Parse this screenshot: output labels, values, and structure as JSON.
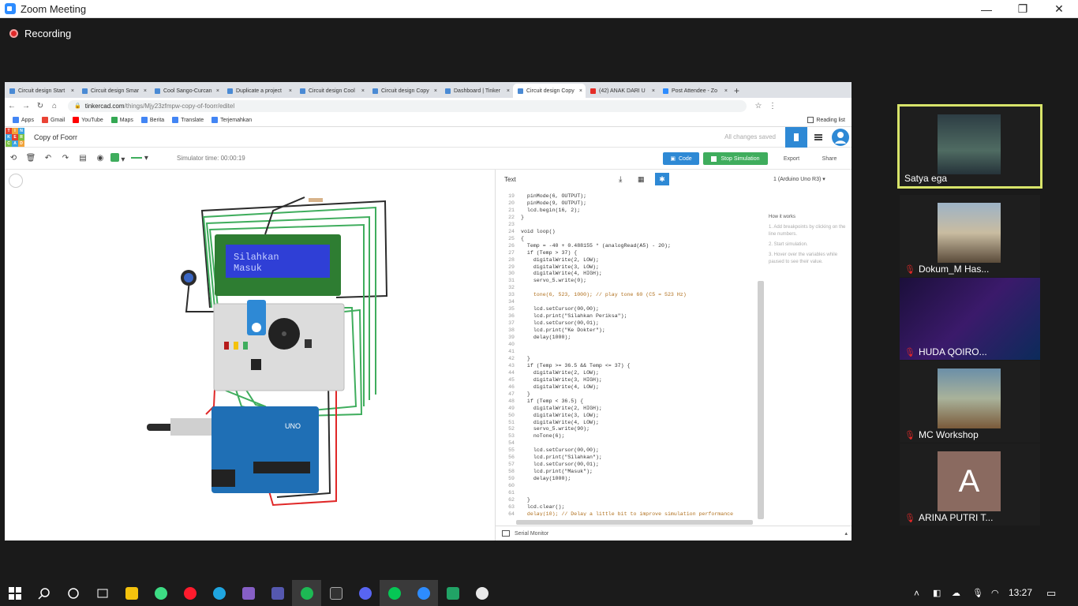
{
  "zoom": {
    "title": "Zoom Meeting",
    "recording": "Recording",
    "minimize": "—",
    "restore": "❐",
    "close": "✕"
  },
  "browser": {
    "tabs": [
      "Circuit design Start",
      "Circuit design Smar",
      "Cool Sango-Curcan",
      "Duplicate a project",
      "Circuit design Cool",
      "Circuit design Copy",
      "Dashboard | Tinker",
      "Circuit design Copy",
      "(42) ANAK DARI U",
      "Post Attendee - Zo"
    ],
    "tab_close": "×",
    "new_tab": "+",
    "url_host": "tinkercad.com",
    "url_path": "/things/Mjy23zfmpw-copy-of-foorr/editel",
    "bookmarks": [
      "Apps",
      "Gmail",
      "YouTube",
      "Maps",
      "Berita",
      "Translate",
      "Terjemahkan"
    ],
    "reading_list": "Reading list"
  },
  "tinkercad": {
    "logo_letters": [
      "T",
      "I",
      "N",
      "K",
      "E",
      "R",
      "C",
      "A",
      "D"
    ],
    "project_name": "Copy of Foorr",
    "save_status": "All changes saved",
    "simulator_time": "Simulator time: 00:00:19",
    "code_button": "Code",
    "stop_button": "Stop Simulation",
    "export_button": "Export",
    "share_button": "Share",
    "code_mode": "Text",
    "board": "1 (Arduino Uno R3)",
    "lcd_line1": "Silahkan",
    "lcd_line2": "Masuk",
    "serial_monitor": "Serial Monitor",
    "how_title": "How it works",
    "how_steps": [
      "1. Add breakpoints by clicking on the line numbers.",
      "2. Start simulation.",
      "3. Hover over the variables while paused to see their value."
    ],
    "arduino_label": "UNO",
    "code_lines": [
      {
        "n": "19",
        "t": "  pinMode(6, OUTPUT);"
      },
      {
        "n": "20",
        "t": "  pinMode(9, OUTPUT);"
      },
      {
        "n": "21",
        "t": "  lcd.begin(16, 2);"
      },
      {
        "n": "22",
        "t": "}"
      },
      {
        "n": "23",
        "t": ""
      },
      {
        "n": "24",
        "t": "void loop()"
      },
      {
        "n": "25",
        "t": "{"
      },
      {
        "n": "26",
        "t": "  Temp = -40 + 0.488155 * (analogRead(A5) - 20);"
      },
      {
        "n": "27",
        "t": "  if (Temp > 37) {"
      },
      {
        "n": "28",
        "t": "    digitalWrite(2, LOW);"
      },
      {
        "n": "29",
        "t": "    digitalWrite(3, LOW);"
      },
      {
        "n": "30",
        "t": "    digitalWrite(4, HIGH);"
      },
      {
        "n": "31",
        "t": "    servo_5.write(0);"
      },
      {
        "n": "32",
        "t": ""
      },
      {
        "n": "33",
        "t": "    tone(6, 523, 1000); // play tone 60 (C5 = 523 Hz)"
      },
      {
        "n": "34",
        "t": ""
      },
      {
        "n": "35",
        "t": "    lcd.setCursor(00,00);"
      },
      {
        "n": "36",
        "t": "    lcd.print(\"Silahkan Periksa\");"
      },
      {
        "n": "37",
        "t": "    lcd.setCursor(00,01);"
      },
      {
        "n": "38",
        "t": "    lcd.print(\"Ke Dokter\");"
      },
      {
        "n": "39",
        "t": "    delay(1000);"
      },
      {
        "n": "40",
        "t": ""
      },
      {
        "n": "41",
        "t": ""
      },
      {
        "n": "42",
        "t": "  }"
      },
      {
        "n": "43",
        "t": "  if (Temp >= 36.5 && Temp <= 37) {"
      },
      {
        "n": "44",
        "t": "    digitalWrite(2, LOW);"
      },
      {
        "n": "45",
        "t": "    digitalWrite(3, HIGH);"
      },
      {
        "n": "46",
        "t": "    digitalWrite(4, LOW);"
      },
      {
        "n": "47",
        "t": "  }"
      },
      {
        "n": "48",
        "t": "  if (Temp < 36.5) {"
      },
      {
        "n": "49",
        "t": "    digitalWrite(2, HIGH);"
      },
      {
        "n": "50",
        "t": "    digitalWrite(3, LOW);"
      },
      {
        "n": "51",
        "t": "    digitalWrite(4, LOW);"
      },
      {
        "n": "52",
        "t": "    servo_5.write(90);"
      },
      {
        "n": "53",
        "t": "    noTone(6);"
      },
      {
        "n": "54",
        "t": ""
      },
      {
        "n": "55",
        "t": "    lcd.setCursor(00,00);"
      },
      {
        "n": "56",
        "t": "    lcd.print(\"Silahkan\");"
      },
      {
        "n": "57",
        "t": "    lcd.setCursor(00,01);"
      },
      {
        "n": "58",
        "t": "    lcd.print(\"Masuk\");"
      },
      {
        "n": "59",
        "t": "    delay(1000);"
      },
      {
        "n": "60",
        "t": ""
      },
      {
        "n": "61",
        "t": ""
      },
      {
        "n": "62",
        "t": "  }"
      },
      {
        "n": "63",
        "t": "  lcd.clear();"
      },
      {
        "n": "64",
        "t": "  delay(10); // Delay a little bit to improve simulation performance"
      },
      {
        "n": "65",
        "t": "}"
      }
    ]
  },
  "participants": [
    {
      "name": "Satya ega",
      "muted": false
    },
    {
      "name": "Dokum_M Has...",
      "muted": true
    },
    {
      "name": "HUDA QOIRO...",
      "muted": true
    },
    {
      "name": "MC Workshop",
      "muted": true
    },
    {
      "name": "ARINA PUTRI T...",
      "muted": true,
      "initial": "A"
    }
  ],
  "taskbar": {
    "clock": "13:27"
  },
  "colors": {
    "tinkercad_blue": "#2e89d5",
    "stop_green": "#3fad5d",
    "active_speaker": "#d8e46a",
    "lcd_bg": "#2f3fd6"
  }
}
